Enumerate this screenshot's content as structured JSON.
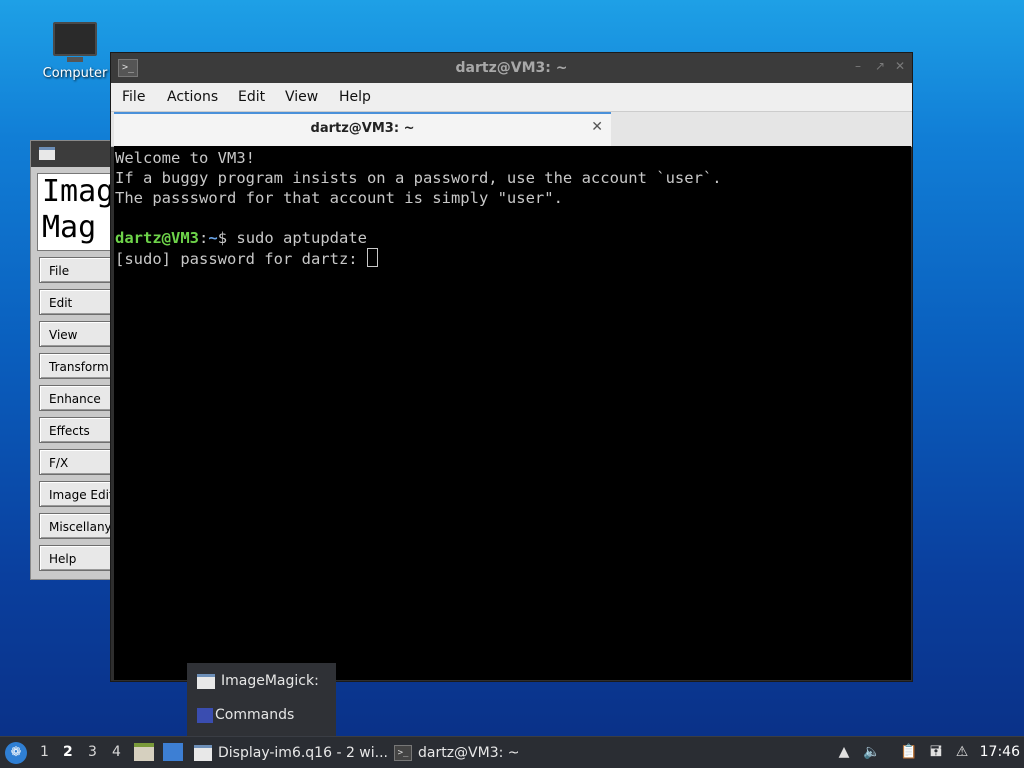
{
  "desktop": {
    "computer_label": "Computer"
  },
  "imagemagick": {
    "logo": "Image\nMagick",
    "buttons": [
      "File",
      "Edit",
      "View",
      "Transform",
      "Enhance",
      "Effects",
      "F/X",
      "Image Edit",
      "Miscellany",
      "Help"
    ]
  },
  "terminal": {
    "title": "dartz@VM3: ~",
    "menu": [
      "File",
      "Actions",
      "Edit",
      "View",
      "Help"
    ],
    "tab_label": "dartz@VM3: ~",
    "lines": [
      "Welcome to VM3!",
      "If a buggy program insists on a password, use the account `user`.",
      "The passsword for that account is simply \"user\"."
    ],
    "prompt_user": "dartz@VM3",
    "prompt_sep": ":",
    "prompt_path": "~",
    "prompt_end": "$ ",
    "command": "sudo aptupdate",
    "sudo_prompt": "[sudo] password for dartz: "
  },
  "popup": {
    "items": [
      "ImageMagick:",
      "Commands"
    ]
  },
  "taskbar": {
    "workspaces": [
      "1",
      "2",
      "3",
      "4"
    ],
    "active_workspace": "2",
    "tasks": [
      "Display-im6.q16 - 2 wi...",
      "dartz@VM3: ~"
    ],
    "clock": "17:46"
  }
}
